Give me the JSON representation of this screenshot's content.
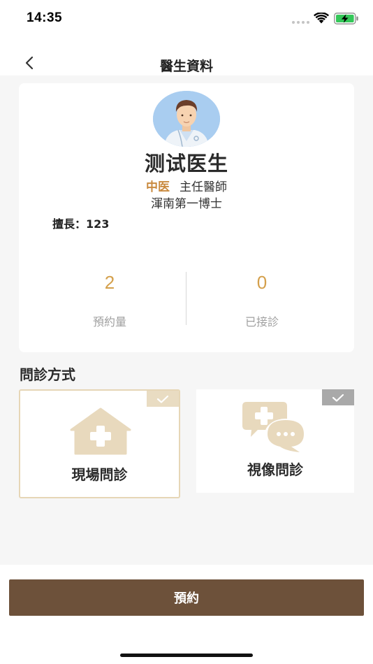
{
  "status_bar": {
    "time": "14:35",
    "icons": [
      "signal-dots-icon",
      "wifi-icon",
      "battery-charging-icon"
    ],
    "battery_color": "#34c759"
  },
  "nav": {
    "back_icon": "chevron-left-icon",
    "title": "醫生資料"
  },
  "doctor": {
    "avatar_icon": "doctor-avatar-icon",
    "name": "测试医生",
    "department": "中医",
    "title": "主任醫師",
    "hospital": "渾南第一博士",
    "specialty": "擅長：123"
  },
  "stats": [
    {
      "value": "2",
      "label": "預約量"
    },
    {
      "value": "0",
      "label": "已接診"
    }
  ],
  "consultation": {
    "section_title": "問診方式",
    "options": [
      {
        "label": "現場問診",
        "icon": "house-medical-icon",
        "badge_icon": "check-icon",
        "badge_color": "#e9dcc2"
      },
      {
        "label": "視像問診",
        "icon": "chat-medical-icon",
        "badge_icon": "check-icon",
        "badge_color": "#a9a9a9"
      }
    ]
  },
  "actions": {
    "book_label": "預約"
  },
  "colors": {
    "accent_gold": "#d4a04c",
    "department_orange": "#c98a3f",
    "primary_brown": "#6d513a",
    "icon_beige": "#e8d9bd",
    "page_background": "#f6f6f6"
  }
}
